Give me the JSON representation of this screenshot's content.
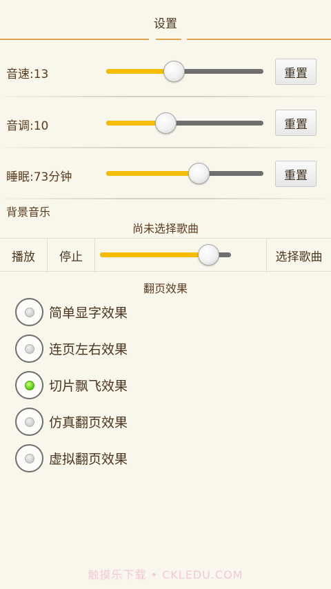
{
  "header": {
    "title": "设置"
  },
  "speed": {
    "label": "音速:13",
    "reset_label": "重置",
    "value_fraction": 0.43
  },
  "pitch": {
    "label": "音调:10",
    "reset_label": "重置",
    "value_fraction": 0.38
  },
  "sleep": {
    "label": "睡眠:73分钟",
    "reset_label": "重置",
    "value_fraction": 0.59
  },
  "music": {
    "section_label": "背景音乐",
    "song_status": "尚未选择歌曲",
    "play_label": "播放",
    "stop_label": "停止",
    "choose_label": "选择歌曲",
    "volume_fraction": 0.83
  },
  "page_effect": {
    "title": "翻页效果",
    "options": [
      {
        "label": "简单显字效果",
        "checked": false
      },
      {
        "label": "连页左右效果",
        "checked": false
      },
      {
        "label": "切片飘飞效果",
        "checked": true
      },
      {
        "label": "仿真翻页效果",
        "checked": false
      },
      {
        "label": "虚拟翻页效果",
        "checked": false
      }
    ]
  },
  "watermark": "触摸乐下载 • CKLEDU.COM",
  "colors": {
    "accent_orange": "#e1a04a",
    "slider_fill": "#f6bd00",
    "radio_checked": "#55c810",
    "background": "#f9f6ec"
  }
}
